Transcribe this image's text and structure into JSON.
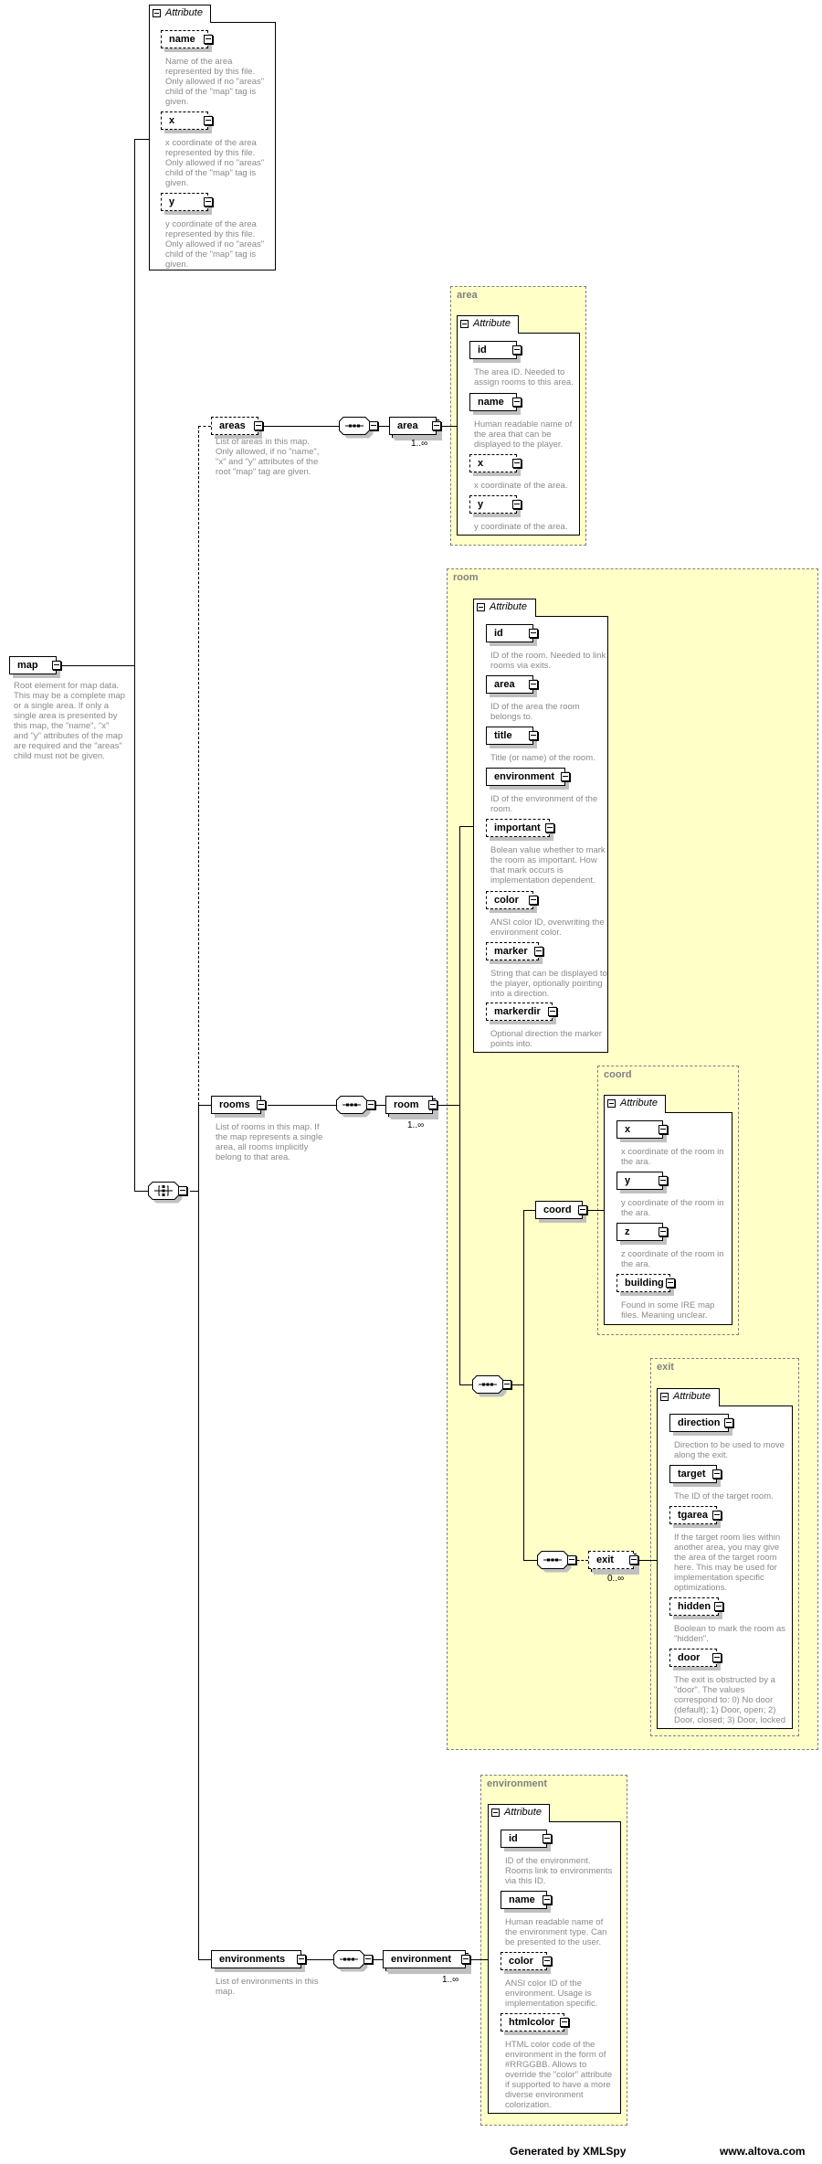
{
  "colors": {
    "group_fill": "#ffffc8",
    "group_border": "#808080",
    "description_text": "#8a8a8a",
    "shadow": "#c0c0c0"
  },
  "map": {
    "name": "map",
    "description": "Root element for map data. This may be a complete map or a single area. If only a single area is presented by this map, the \"name\", \"x\" and \"y\" attributes of the map are required and the \"areas\" child must not be given."
  },
  "map_attributes": {
    "header": "Attribute",
    "items": [
      {
        "name": "name",
        "optional": true,
        "description": "Name of the area represented by this file. Only allowed if no \"areas\" child of the \"map\" tag is given."
      },
      {
        "name": "x",
        "optional": true,
        "description": "x coordinate of the area represented by this file. Only allowed if no \"areas\" child of the \"map\" tag is given."
      },
      {
        "name": "y",
        "optional": true,
        "description": "y coordinate of the area represented by this file. Only allowed if no \"areas\" child of the \"map\" tag is given."
      }
    ]
  },
  "map_compositor": {
    "type": "choice",
    "icon": "choice-compositor-icon"
  },
  "areas": {
    "name": "areas",
    "optional": true,
    "description": "List of areas in this map. Only allowed, if no \"name\", \"x\" and \"y\" attributes of the root \"map\" tag are given.",
    "compositor": "sequence",
    "child": {
      "name": "area",
      "multiplicity": "1..∞"
    },
    "type": {
      "label": "area",
      "header": "Attribute",
      "items": [
        {
          "name": "id",
          "optional": false,
          "description": "The area ID. Needed to assign rooms to this area."
        },
        {
          "name": "name",
          "optional": false,
          "description": "Human readable name of the area that can be displayed to the player."
        },
        {
          "name": "x",
          "optional": true,
          "description": "x coordinate of the area."
        },
        {
          "name": "y",
          "optional": true,
          "description": "y coordinate of the area."
        }
      ]
    }
  },
  "rooms": {
    "name": "rooms",
    "optional": false,
    "description": "List of rooms in this map. If the map represents a single area, all rooms implicitly belong to that area.",
    "compositor": "sequence",
    "child": {
      "name": "room",
      "multiplicity": "1..∞"
    },
    "type": {
      "label": "room",
      "header": "Attribute",
      "items": [
        {
          "name": "id",
          "optional": false,
          "description": "ID of the room. Needed to link rooms via exits."
        },
        {
          "name": "area",
          "optional": false,
          "description": "ID of the area the room belongs to."
        },
        {
          "name": "title",
          "optional": false,
          "description": "Title (or name) of the room."
        },
        {
          "name": "environment",
          "optional": false,
          "description": "ID of the environment of the room."
        },
        {
          "name": "important",
          "optional": true,
          "description": "Bolean value whether to mark the room as important. How that mark occurs is implementation dependent."
        },
        {
          "name": "color",
          "optional": true,
          "description": "ANSI color ID, overwriting the environment color."
        },
        {
          "name": "marker",
          "optional": true,
          "description": "String that can be displayed to the player, optionally pointing into a direction."
        },
        {
          "name": "markerdir",
          "optional": true,
          "description": "Optional direction the marker points into."
        }
      ]
    },
    "coord": {
      "name": "coord",
      "label": "coord",
      "header": "Attribute",
      "items": [
        {
          "name": "x",
          "optional": false,
          "description": "x coordinate of the room in the ara."
        },
        {
          "name": "y",
          "optional": false,
          "description": "y coordinate of the room in the ara."
        },
        {
          "name": "z",
          "optional": false,
          "description": "z coordinate of the room in the ara."
        },
        {
          "name": "building",
          "optional": true,
          "description": "Found in some IRE map files. Meaning unclear."
        }
      ]
    },
    "exit": {
      "name": "exit",
      "multiplicity": "0..∞",
      "label": "exit",
      "header": "Attribute",
      "items": [
        {
          "name": "direction",
          "optional": false,
          "description": "Direction to be used to move along the exit."
        },
        {
          "name": "target",
          "optional": false,
          "description": "The ID of the target room."
        },
        {
          "name": "tgarea",
          "optional": true,
          "description": "If the target room lies within another area, you may give the area of the target room here. This may be used for implementation specific optimizations."
        },
        {
          "name": "hidden",
          "optional": true,
          "description": "Boolean to mark the room as \"hidden\"."
        },
        {
          "name": "door",
          "optional": true,
          "description": "The exit is obstructed by a \"door\". The values correspond to: 0) No door (default); 1) Door, open; 2) Door, closed; 3) Door, locked"
        }
      ]
    }
  },
  "environments": {
    "name": "environments",
    "optional": false,
    "description": "List of environments in this map.",
    "compositor": "sequence",
    "child": {
      "name": "environment",
      "multiplicity": "1..∞"
    },
    "type": {
      "label": "environment",
      "header": "Attribute",
      "items": [
        {
          "name": "id",
          "optional": false,
          "description": "ID of the environment. Rooms link to environments via this ID."
        },
        {
          "name": "name",
          "optional": false,
          "description": "Human readable name of the environment type. Can be presented to the user."
        },
        {
          "name": "color",
          "optional": true,
          "description": "ANSI color ID of the environment. Usage is implementation specific."
        },
        {
          "name": "htmlcolor",
          "optional": true,
          "description": "HTML color code of the environment in the form of #RRGGBB. Allows to override the \"color\" attribute if supported to have a more diverse environment colorization."
        }
      ]
    }
  },
  "footer": {
    "generator": "Generated by XMLSpy",
    "site": "www.altova.com"
  }
}
